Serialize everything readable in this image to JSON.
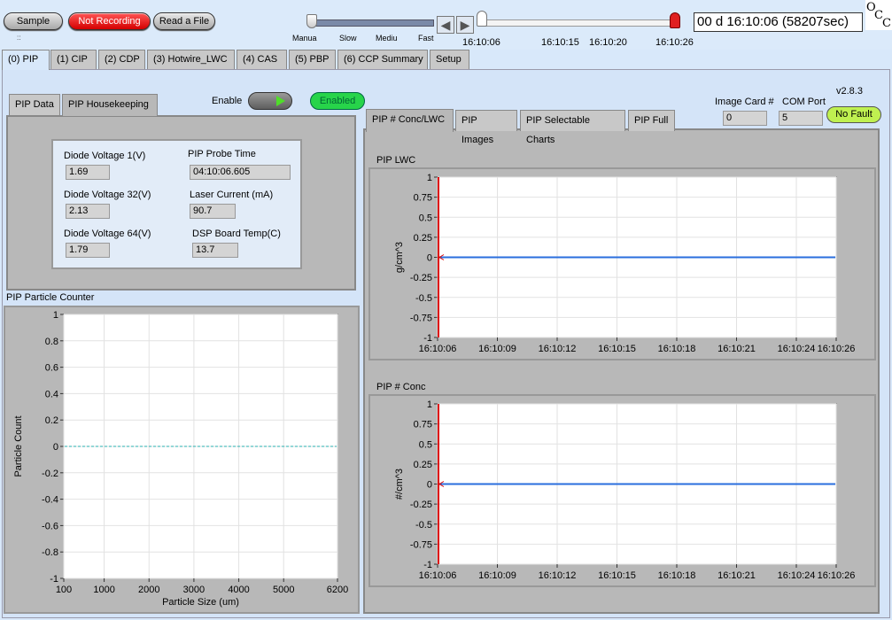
{
  "toolbar": {
    "sample_label": "Sample",
    "recording_label": "Not Recording",
    "read_file_label": "Read a File",
    "dots": "::",
    "speed_labels": [
      "Manua",
      "Slow",
      "Mediu",
      "Fast"
    ],
    "time_labels": [
      "16:10:06",
      "16:10:15",
      "16:10:20",
      "16:10:26"
    ],
    "time_display": "00 d 16:10:06 (58207sec)",
    "logo_text": "OCC"
  },
  "main_tabs": [
    {
      "label": "(0) PIP"
    },
    {
      "label": "(1) CIP"
    },
    {
      "label": "(2) CDP"
    },
    {
      "label": "(3) Hotwire_LWC"
    },
    {
      "label": "(4) CAS"
    },
    {
      "label": "(5) PBP"
    },
    {
      "label": "(6) CCP Summary"
    },
    {
      "label": "Setup"
    }
  ],
  "left": {
    "sub_tabs": [
      "PIP Data",
      "PIP Housekeeping"
    ],
    "enable_label": "Enable",
    "enabled_badge": "Enabled",
    "housekeeping": {
      "diode1_label": "Diode Voltage 1(V)",
      "diode1_value": "1.69",
      "probe_time_label": "PIP Probe Time",
      "probe_time_value": "04:10:06.605",
      "diode32_label": "Diode Voltage 32(V)",
      "diode32_value": "2.13",
      "laser_label": "Laser Current (mA)",
      "laser_value": "90.7",
      "diode64_label": "Diode Voltage 64(V)",
      "diode64_value": "1.79",
      "dsp_label": "DSP Board Temp(C)",
      "dsp_value": "13.7"
    },
    "counter_title": "PIP Particle Counter"
  },
  "right": {
    "version": "v2.8.3",
    "image_card_label": "Image Card #",
    "image_card_value": "0",
    "com_port_label": "COM Port",
    "com_port_value": "5",
    "fault_status": "No Fault",
    "sub_tabs": [
      "PIP # Conc/LWC",
      "PIP Images",
      "PIP Selectable Charts",
      "PIP Full"
    ],
    "lwc_title": "PIP LWC",
    "conc_title": "PIP # Conc"
  },
  "colors": {
    "background": "#d8e8fa",
    "recording_red": "#e00000",
    "enabled_green": "#27d44a",
    "nofault_green": "#bff050",
    "series_blue": "#2a6ede",
    "dashed_teal": "#2ab0b0",
    "cursor_red": "#dd0000"
  },
  "chart_data": [
    {
      "type": "line",
      "title": "PIP Particle Counter",
      "xlabel": "Particle Size (um)",
      "ylabel": "Particle Count",
      "x_ticks": [
        "100",
        "1000",
        "2000",
        "3000",
        "4000",
        "5000",
        "6200"
      ],
      "y_ticks": [
        "1",
        "0.8",
        "0.6",
        "0.4",
        "0.2",
        "0",
        "-0.2",
        "-0.4",
        "-0.6",
        "-0.8",
        "-1"
      ],
      "xlim": [
        100,
        6200
      ],
      "ylim": [
        -1,
        1
      ],
      "grid": true,
      "series": [
        {
          "x": [
            100,
            6200
          ],
          "y": [
            0,
            0
          ],
          "style": "dashed"
        }
      ]
    },
    {
      "type": "line",
      "title": "PIP LWC",
      "xlabel": "",
      "ylabel": "g/cm^3",
      "x_ticks": [
        "16:10:06",
        "16:10:09",
        "16:10:12",
        "16:10:15",
        "16:10:18",
        "16:10:21",
        "16:10:24",
        "16:10:26"
      ],
      "y_ticks": [
        "1",
        "0.75",
        "0.5",
        "0.25",
        "0",
        "-0.25",
        "-0.5",
        "-0.75",
        "-1"
      ],
      "ylim": [
        -1,
        1
      ],
      "grid": true,
      "series": [
        {
          "x": [
            "16:10:06",
            "16:10:26"
          ],
          "y": [
            0,
            0
          ]
        }
      ]
    },
    {
      "type": "line",
      "title": "PIP # Conc",
      "xlabel": "",
      "ylabel": "#/cm^3",
      "x_ticks": [
        "16:10:06",
        "16:10:09",
        "16:10:12",
        "16:10:15",
        "16:10:18",
        "16:10:21",
        "16:10:24",
        "16:10:26"
      ],
      "y_ticks": [
        "1",
        "0.75",
        "0.5",
        "0.25",
        "0",
        "-0.25",
        "-0.5",
        "-0.75",
        "-1"
      ],
      "ylim": [
        -1,
        1
      ],
      "grid": true,
      "series": [
        {
          "x": [
            "16:10:06",
            "16:10:26"
          ],
          "y": [
            0,
            0
          ]
        }
      ]
    }
  ]
}
